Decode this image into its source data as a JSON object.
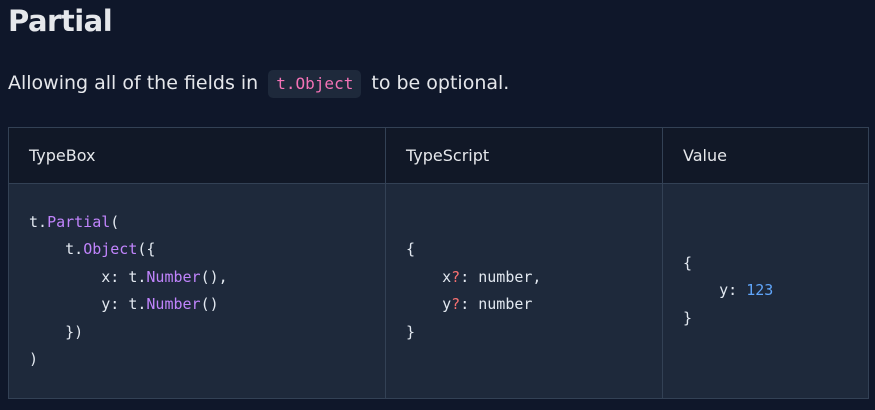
{
  "heading": "Partial",
  "description": {
    "before": "Allowing all of the fields in",
    "code": "t.Object",
    "after": "to be optional."
  },
  "table": {
    "headers": [
      "TypeBox",
      "TypeScript",
      "Value"
    ],
    "typebox_lines": [
      "t.Partial(",
      "    t.Object({",
      "        x: t.Number(),",
      "        y: t.Number()",
      "    })",
      ")"
    ],
    "typescript_lines": [
      "{",
      "    x?: number,",
      "    y?: number",
      "}"
    ],
    "value_lines": [
      "{",
      "    y: 123",
      "}"
    ]
  }
}
